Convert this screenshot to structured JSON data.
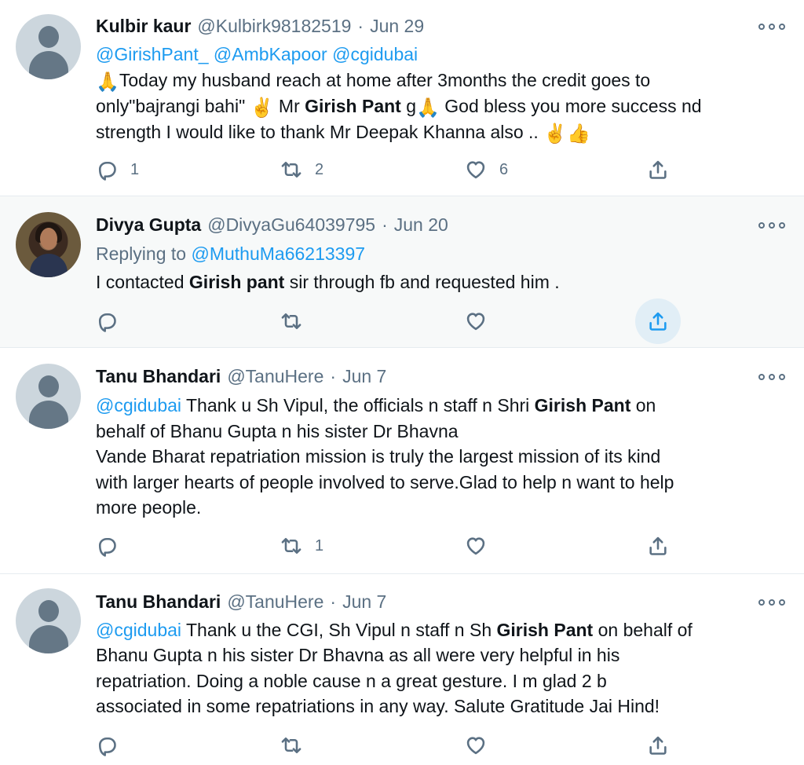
{
  "tweets": [
    {
      "name": "Kulbir kaur",
      "handle": "@Kulbirk98182519",
      "sep": "·",
      "date": "Jun 29",
      "lines": {
        "l1": [
          "@GirishPant_",
          "@AmbKapoor",
          "@cgidubai"
        ],
        "l2": {
          "emoji_a": "🙏",
          "text": "Today my husband reach at home after 3months the credit goes to"
        },
        "l3": {
          "t1": "only\"bajrangi bahi\" ",
          "emoji_a": "✌️",
          "t2": " Mr ",
          "bold": "Girish Pant",
          "t3": " g",
          "emoji_b": "🙏",
          "t4": " God bless you more success nd"
        },
        "l4": {
          "text": "strength I would like to thank Mr Deepak Khanna also .. ",
          "emoji_a": "✌️",
          "emoji_b": "👍"
        }
      },
      "actions": {
        "reply": "1",
        "retweet": "2",
        "like": "6"
      }
    },
    {
      "name": "Divya Gupta",
      "handle": "@DivyaGu64039795",
      "sep": "·",
      "date": "Jun 20",
      "replying_prefix": "Replying to ",
      "replying_to": "@MuthuMa66213397",
      "lines": {
        "l1": {
          "t1": "I contacted ",
          "bold": "Girish pant",
          "t2": " sir through fb and requested him ."
        }
      }
    },
    {
      "name": "Tanu Bhandari",
      "handle": "@TanuHere",
      "sep": "·",
      "date": "Jun 7",
      "lines": {
        "l1": {
          "mention": "@cgidubai",
          "t1": " Thank u Sh Vipul, the officials n staff n Shri ",
          "bold": "Girish Pant",
          "t2": " on"
        },
        "l2": "behalf of Bhanu Gupta n his sister Dr Bhavna",
        "l3": "Vande Bharat repatriation mission is truly the largest mission of its kind",
        "l4": "with larger hearts of people involved to serve.Glad to help n want to help",
        "l5": "more people."
      },
      "actions": {
        "retweet": "1"
      }
    },
    {
      "name": "Tanu Bhandari",
      "handle": "@TanuHere",
      "sep": "·",
      "date": "Jun 7",
      "lines": {
        "l1": {
          "mention": "@cgidubai",
          "t1": " Thank u the CGI, Sh Vipul n staff n Sh ",
          "bold": "Girish Pant",
          "t2": " on behalf of"
        },
        "l2": "Bhanu Gupta n his sister Dr Bhavna as all were very helpful in his",
        "l3": "repatriation. Doing a noble cause n a great gesture. I m glad 2 b",
        "l4": "associated in some repatriations in any way. Salute Gratitude Jai Hind!"
      }
    }
  ],
  "icons": {
    "reply": "reply-icon",
    "retweet": "retweet-icon",
    "like": "like-icon",
    "share": "share-icon",
    "more": "more-icon"
  },
  "colors": {
    "link": "#1d9bf0",
    "secondary_text": "#5b7083",
    "hover_background": "#f7f9f9",
    "share_highlight": "#e1eef6"
  }
}
